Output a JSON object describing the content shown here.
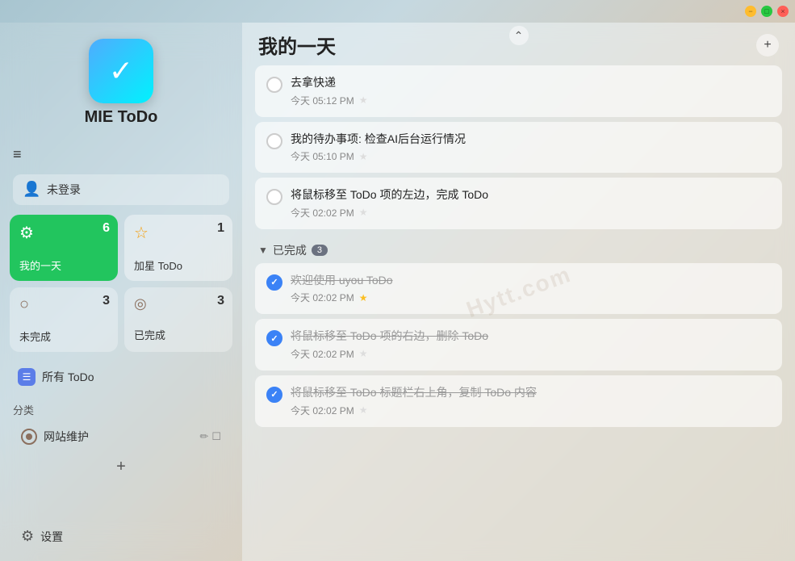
{
  "app": {
    "title": "MIE ToDo",
    "icon_label": "✓"
  },
  "window_controls": {
    "close_label": "×",
    "minimize_label": "−",
    "maximize_label": "□"
  },
  "sidebar": {
    "hamburger_icon": "≡",
    "user": {
      "label": "未登录",
      "icon": "👤"
    },
    "smart_lists": [
      {
        "id": "my-day",
        "label": "我的一天",
        "count": "6",
        "icon": "⚙",
        "type": "my-day"
      },
      {
        "id": "starred",
        "label": "加星 ToDo",
        "count": "1",
        "icon": "☆",
        "type": "starred"
      },
      {
        "id": "incomplete",
        "label": "未完成",
        "count": "3",
        "icon": "○",
        "type": "incomplete"
      },
      {
        "id": "complete",
        "label": "已完成",
        "count": "3",
        "icon": "◎",
        "type": "complete"
      }
    ],
    "all_todo": {
      "label": "所有 ToDo",
      "icon": "☰"
    },
    "category_section": {
      "title": "分类",
      "items": [
        {
          "id": "website",
          "label": "网站维护",
          "color": "#8b6f5e"
        }
      ],
      "add_label": "+"
    },
    "settings": {
      "label": "设置",
      "icon": "⚙"
    }
  },
  "content": {
    "title": "我的一天",
    "scroll_up_icon": "⌃",
    "add_icon": "+",
    "tasks": [
      {
        "id": "task1",
        "title": "去拿快递",
        "time": "今天 05:12 PM",
        "starred": false,
        "completed": false
      },
      {
        "id": "task2",
        "title": "我的待办事项: 检查AI后台运行情况",
        "time": "今天 05:10 PM",
        "starred": false,
        "completed": false
      },
      {
        "id": "task3",
        "title": "将鼠标移至 ToDo 项的左边，完成 ToDo",
        "time": "今天 02:02 PM",
        "starred": false,
        "completed": false
      }
    ],
    "completed_section": {
      "label": "已完成",
      "count": "3",
      "chevron": "▼",
      "items": [
        {
          "id": "done1",
          "title": "欢迎使用 uyou ToDo",
          "time": "今天 02:02 PM",
          "starred": true,
          "completed": true
        },
        {
          "id": "done2",
          "title": "将鼠标移至 ToDo 项的右边，删除 ToDo",
          "time": "今天 02:02 PM",
          "starred": false,
          "completed": true
        },
        {
          "id": "done3",
          "title": "将鼠标移至 ToDo 标题栏右上角，复制 ToDo 内容",
          "time": "今天 02:02 PM",
          "starred": false,
          "completed": true
        }
      ]
    }
  },
  "watermark": {
    "text": "Hytt.com"
  }
}
